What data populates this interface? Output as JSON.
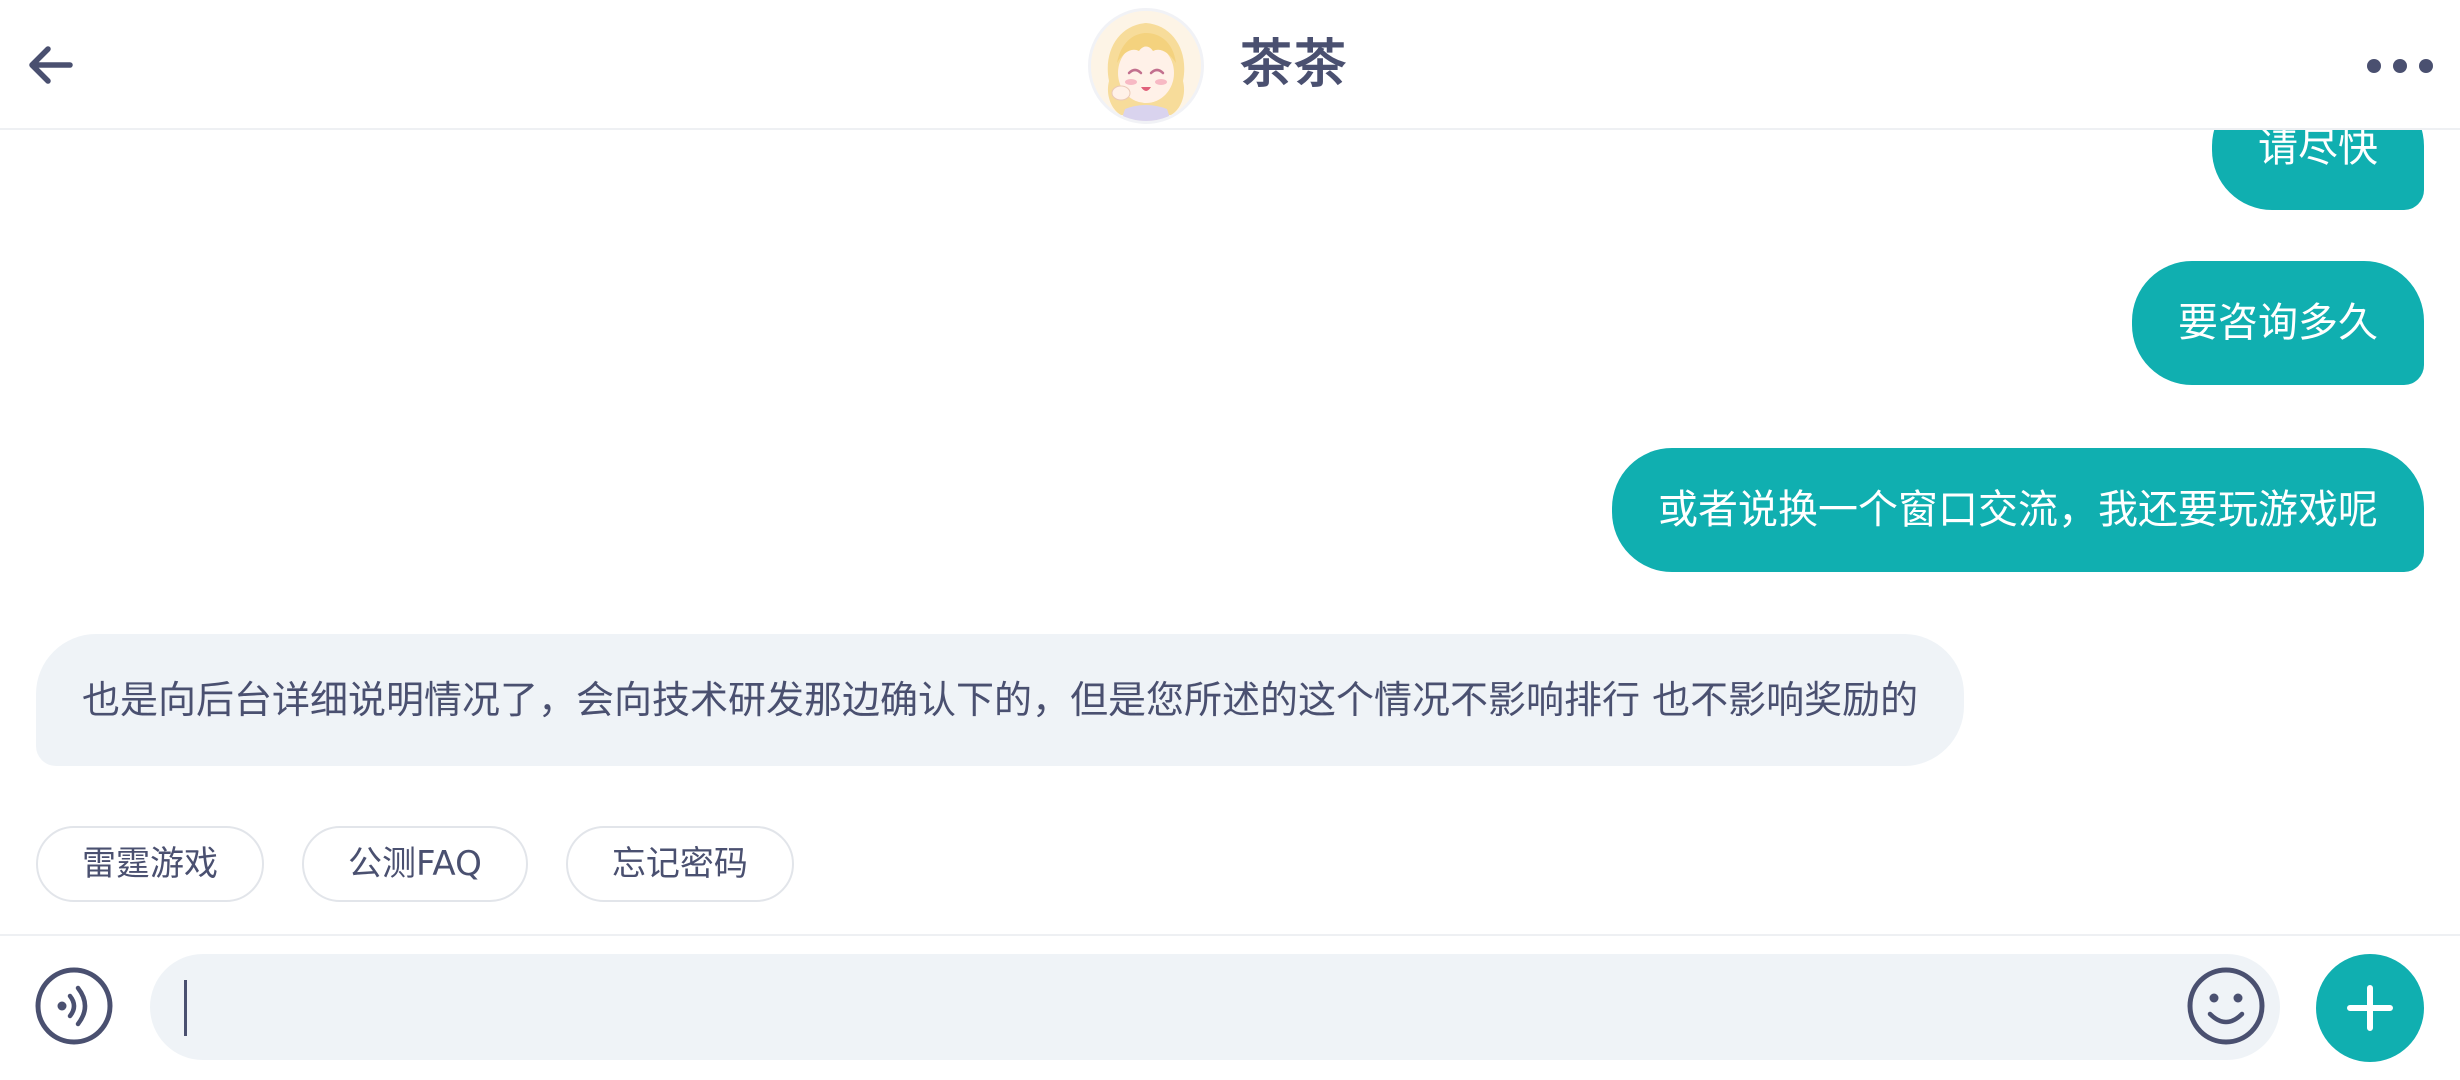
{
  "header": {
    "title": "茶茶",
    "back_icon": "arrow-left-icon",
    "more_icon": "more-dots-icon",
    "avatar": "anime-avatar"
  },
  "messages": [
    {
      "direction": "outgoing",
      "text": "请尽快"
    },
    {
      "direction": "outgoing",
      "text": "要咨询多久"
    },
    {
      "direction": "outgoing",
      "text": "或者说换一个窗口交流，我还要玩游戏呢"
    },
    {
      "direction": "incoming",
      "text": "也是向后台详细说明情况了，会向技术研发那边确认下的，但是您所述的这个情况不影响排行 也不影响奖励的"
    }
  ],
  "quick_replies": [
    "雷霆游戏",
    "公测FAQ",
    "忘记密码"
  ],
  "input_bar": {
    "value": "",
    "voice_icon": "voice-icon",
    "emoji_icon": "emoji-icon",
    "plus_icon": "plus-icon"
  },
  "colors": {
    "accent": "#10afb0",
    "incoming_bubble": "#eff3f7",
    "text": "#4a5070"
  }
}
